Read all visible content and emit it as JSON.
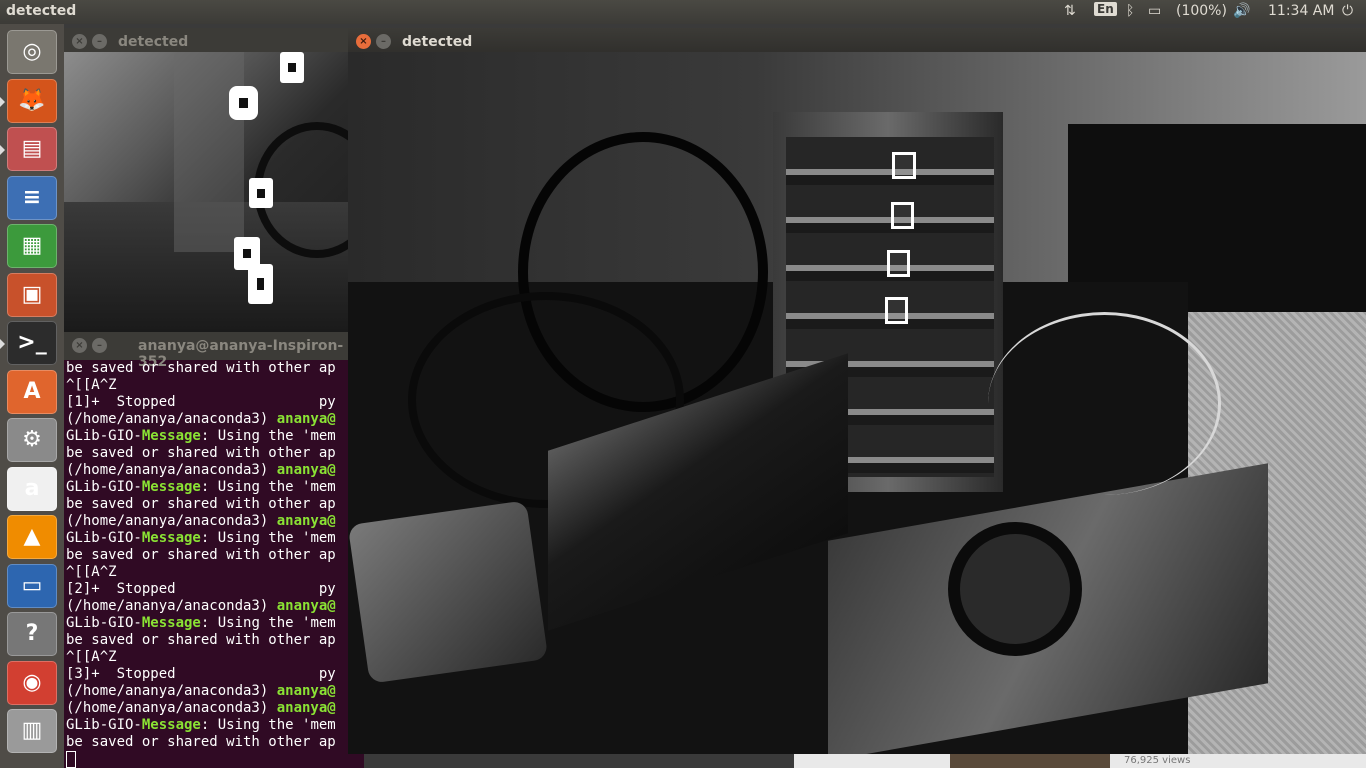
{
  "topbar": {
    "app_title": "detected",
    "keyboard_layout": "En",
    "battery": "(100%)",
    "time": "11:34 AM",
    "icons": [
      "network-transfer-icon",
      "bluetooth-icon",
      "battery-icon",
      "volume-icon",
      "power-icon"
    ]
  },
  "launcher": {
    "items": [
      {
        "name": "ubuntu-dash-icon",
        "glyph": "◎",
        "color": "#7a776f"
      },
      {
        "name": "firefox-icon",
        "glyph": "🦊",
        "color": "#d4541b"
      },
      {
        "name": "files-icon",
        "glyph": "▤",
        "color": "#c05050"
      },
      {
        "name": "writer-icon",
        "glyph": "≡",
        "color": "#3d6fb4"
      },
      {
        "name": "calc-icon",
        "glyph": "▦",
        "color": "#3c9a3c"
      },
      {
        "name": "impress-icon",
        "glyph": "▣",
        "color": "#c8512b"
      },
      {
        "name": "terminal-icon",
        "glyph": ">_",
        "color": "#2c2c2c"
      },
      {
        "name": "software-center-icon",
        "glyph": "A",
        "color": "#e0652d"
      },
      {
        "name": "settings-icon",
        "glyph": "⚙",
        "color": "#8a8a8a"
      },
      {
        "name": "amazon-icon",
        "glyph": "a",
        "color": "#f0f0f0"
      },
      {
        "name": "vlc-icon",
        "glyph": "▲",
        "color": "#f08c00"
      },
      {
        "name": "scanner-icon",
        "glyph": "▭",
        "color": "#2d66b0"
      },
      {
        "name": "help-icon",
        "glyph": "?",
        "color": "#777"
      },
      {
        "name": "chrome-icon",
        "glyph": "◉",
        "color": "#d23f31"
      },
      {
        "name": "trash-icon",
        "glyph": "▥",
        "color": "#9a9a9a"
      }
    ]
  },
  "back_window": {
    "title": "detected"
  },
  "main_window": {
    "title": "detected"
  },
  "terminal": {
    "title": "ananya@ananya-Inspiron-352",
    "lines": [
      {
        "t": "plain",
        "text": "be saved or shared with other ap"
      },
      {
        "t": "plain",
        "text": "^[[A^Z"
      },
      {
        "t": "plain",
        "text": "[1]+  Stopped                 py"
      },
      {
        "t": "user",
        "pre": "(/home/ananya/anaconda3) ",
        "user": "ananya@"
      },
      {
        "t": "msg",
        "pre": "GLib-GIO-",
        "msg": "Message",
        "post": ": Using the 'mem"
      },
      {
        "t": "plain",
        "text": "be saved or shared with other ap"
      },
      {
        "t": "user",
        "pre": "(/home/ananya/anaconda3) ",
        "user": "ananya@"
      },
      {
        "t": "msg",
        "pre": "GLib-GIO-",
        "msg": "Message",
        "post": ": Using the 'mem"
      },
      {
        "t": "plain",
        "text": "be saved or shared with other ap"
      },
      {
        "t": "user",
        "pre": "(/home/ananya/anaconda3) ",
        "user": "ananya@"
      },
      {
        "t": "msg",
        "pre": "GLib-GIO-",
        "msg": "Message",
        "post": ": Using the 'mem"
      },
      {
        "t": "plain",
        "text": "be saved or shared with other ap"
      },
      {
        "t": "plain",
        "text": "^[[A^Z"
      },
      {
        "t": "plain",
        "text": "[2]+  Stopped                 py"
      },
      {
        "t": "user",
        "pre": "(/home/ananya/anaconda3) ",
        "user": "ananya@"
      },
      {
        "t": "msg",
        "pre": "GLib-GIO-",
        "msg": "Message",
        "post": ": Using the 'mem"
      },
      {
        "t": "plain",
        "text": "be saved or shared with other ap"
      },
      {
        "t": "plain",
        "text": "^[[A^Z"
      },
      {
        "t": "plain",
        "text": "[3]+  Stopped                 py"
      },
      {
        "t": "user",
        "pre": "(/home/ananya/anaconda3) ",
        "user": "ananya@"
      },
      {
        "t": "user",
        "pre": "(/home/ananya/anaconda3) ",
        "user": "ananya@"
      },
      {
        "t": "msg",
        "pre": "GLib-GIO-",
        "msg": "Message",
        "post": ": Using the 'mem"
      },
      {
        "t": "plain",
        "text": "be saved or shared with other ap"
      }
    ]
  },
  "background": {
    "view_count": "76,925 views"
  },
  "colors": {
    "terminal_bg": "#300a24",
    "prompt_green": "#8ae234",
    "close_orange": "#e86d3b",
    "panel": "#3c3b37"
  }
}
